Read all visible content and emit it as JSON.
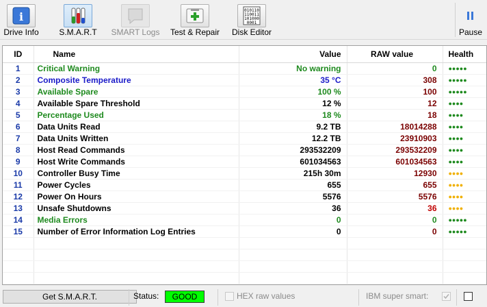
{
  "toolbar": {
    "drive_info": "Drive Info",
    "smart": "S.M.A.R.T",
    "smart_logs": "SMART Logs",
    "test_repair": "Test & Repair",
    "disk_editor": "Disk Editor",
    "pause": "Pause"
  },
  "table": {
    "headers": {
      "id": "ID",
      "name": "Name",
      "value": "Value",
      "raw": "RAW value",
      "health": "Health"
    },
    "rows": [
      {
        "id": "1",
        "name": "Critical Warning",
        "value": "No warning",
        "raw": "0",
        "health": "●●●●●"
      },
      {
        "id": "2",
        "name": "Composite Temperature",
        "value": "35 °C",
        "raw": "308",
        "health": "●●●●●"
      },
      {
        "id": "3",
        "name": "Available Spare",
        "value": "100 %",
        "raw": "100",
        "health": "●●●●●"
      },
      {
        "id": "4",
        "name": "Available Spare Threshold",
        "value": "12 %",
        "raw": "12",
        "health": "●●●●"
      },
      {
        "id": "5",
        "name": "Percentage Used",
        "value": "18 %",
        "raw": "18",
        "health": "●●●●"
      },
      {
        "id": "6",
        "name": "Data Units Read",
        "value": "9.2 TB",
        "raw": "18014288",
        "health": "●●●●"
      },
      {
        "id": "7",
        "name": "Data Units Written",
        "value": "12.2 TB",
        "raw": "23910903",
        "health": "●●●●"
      },
      {
        "id": "8",
        "name": "Host Read Commands",
        "value": "293532209",
        "raw": "293532209",
        "health": "●●●●"
      },
      {
        "id": "9",
        "name": "Host Write Commands",
        "value": "601034563",
        "raw": "601034563",
        "health": "●●●●"
      },
      {
        "id": "10",
        "name": "Controller Busy Time",
        "value": "215h 30m",
        "raw": "12930",
        "health": "●●●●"
      },
      {
        "id": "11",
        "name": "Power Cycles",
        "value": "655",
        "raw": "655",
        "health": "●●●●"
      },
      {
        "id": "12",
        "name": "Power On Hours",
        "value": "5576",
        "raw": "5576",
        "health": "●●●●"
      },
      {
        "id": "13",
        "name": "Unsafe Shutdowns",
        "value": "36",
        "raw": "36",
        "health": "●●●●"
      },
      {
        "id": "14",
        "name": "Media Errors",
        "value": "0",
        "raw": "0",
        "health": "●●●●●"
      },
      {
        "id": "15",
        "name": "Number of Error Information Log Entries",
        "value": "0",
        "raw": "0",
        "health": "●●●●●"
      }
    ]
  },
  "status_bar": {
    "get_smart": "Get S.M.A.R.T.",
    "status_label": "Status:",
    "status_value": "GOOD",
    "hex_raw_values": "HEX raw values",
    "ibm_super_smart": "IBM super smart:",
    "status_color": "#00ff00"
  }
}
